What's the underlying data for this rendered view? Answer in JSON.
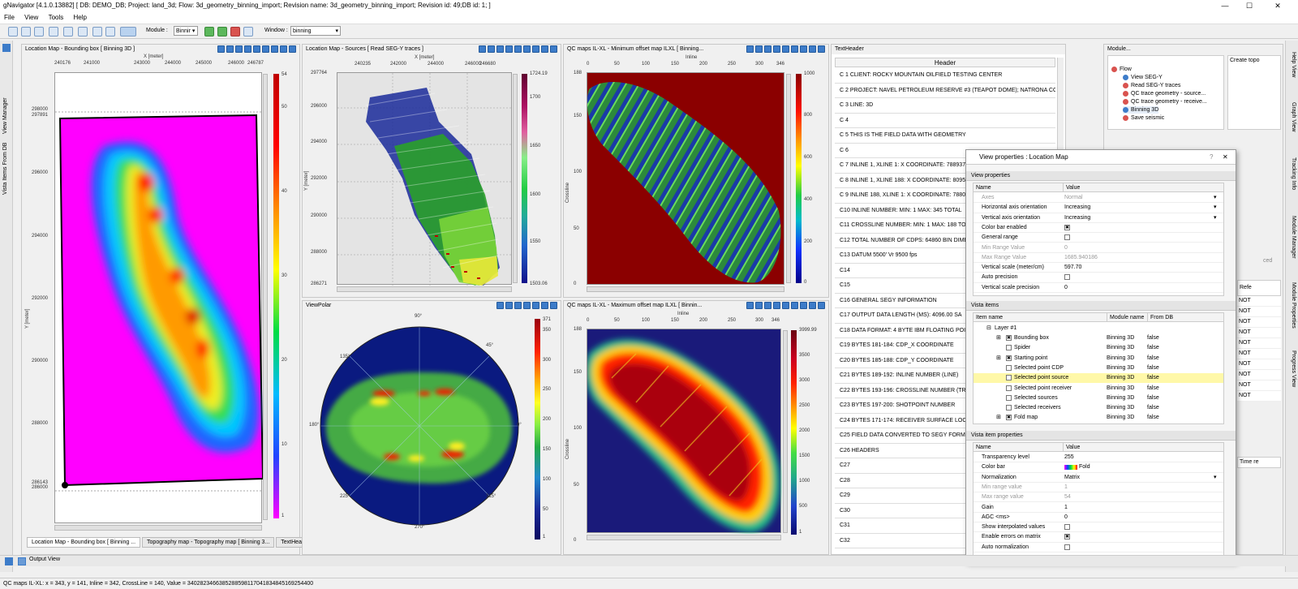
{
  "app": {
    "title": "gNavigator [4.1.0.13882] [ DB: DEMO_DB; Project: land_3d; Flow: 3d_geometry_binning_import; Revision name: 3d_geometry_binning_import; Revision id: 49;DB id: 1; ]",
    "menu": [
      "File",
      "View",
      "Tools",
      "Help"
    ],
    "toolbar": {
      "module_label": "Module :",
      "module_value": "Binnir",
      "window_label": "Window :",
      "window_value": "binning"
    }
  },
  "left_dock": {
    "tab1": "View Manager",
    "tab2": "Vista Items From DB"
  },
  "right_dock": {
    "tabs": [
      "Help View",
      "Graph View",
      "Tracking Info",
      "Module Manager",
      "Module Properties",
      "Progress View"
    ]
  },
  "panel1": {
    "title": "Location Map - Bounding box [ Binning 3D ]",
    "xaxis_title": "X [meter]",
    "yaxis_title": "Y [meter]",
    "xticks": [
      "240176",
      "241000",
      "243000",
      "244000",
      "245000",
      "246000",
      "246787"
    ],
    "yticks": [
      "298000",
      "297891",
      "296000",
      "294000",
      "292000",
      "290000",
      "288000",
      "286143",
      "286000"
    ],
    "cbar_ticks": [
      "54",
      "50",
      "40",
      "30",
      "20",
      "10",
      "1"
    ],
    "tabs": [
      "Location Map - Bounding box [ Binning ...",
      "Topography map - Topography map [ Binning 3...",
      "TextHea..."
    ]
  },
  "panel2": {
    "title": "Location Map - Sources [ Read SEG-Y traces ]",
    "xaxis_title": "X [meter]",
    "yaxis_title": "Y [meter]",
    "xticks": [
      "240235",
      "242000",
      "244000",
      "246000",
      "246680"
    ],
    "yticks": [
      "297764",
      "296000",
      "294000",
      "292000",
      "290000",
      "288000",
      "286271"
    ],
    "cbar_ticks": [
      "1724.19",
      "1700",
      "1650",
      "1600",
      "1550",
      "1503.06"
    ]
  },
  "panel3": {
    "title": "ViewPolar",
    "angles": [
      "90°",
      "45°",
      "0°",
      "315°",
      "270°",
      "225°",
      "180°",
      "135°"
    ],
    "cbar_ticks": [
      "371",
      "350",
      "300",
      "250",
      "200",
      "150",
      "100",
      "50",
      "1"
    ]
  },
  "panel4": {
    "title": "QC maps IL-XL - Minimum offset map ILXL [ Binning...",
    "xaxis_title": "Inline",
    "yaxis_title": "Crossline",
    "xticks": [
      "0",
      "50",
      "100",
      "150",
      "200",
      "250",
      "300",
      "346"
    ],
    "yticks": [
      "188",
      "150",
      "100",
      "50",
      "0"
    ],
    "cbar_ticks": [
      "1000",
      "800",
      "600",
      "400",
      "200",
      "0"
    ]
  },
  "panel5": {
    "title": "QC maps IL-XL - Maximum offset map ILXL [ Binnin...",
    "xaxis_title": "Inline",
    "yaxis_title": "Crossline",
    "xticks": [
      "0",
      "50",
      "100",
      "150",
      "200",
      "250",
      "300",
      "346"
    ],
    "yticks": [
      "188",
      "150",
      "100",
      "50",
      "0"
    ],
    "cbar_ticks": [
      "3999.99",
      "3500",
      "3000",
      "2500",
      "2000",
      "1500",
      "1000",
      "500",
      "1"
    ]
  },
  "textheader": {
    "title": "TextHeader",
    "column": "Header",
    "rows": [
      "C 1 CLIENT: ROCKY MOUNTAIN OILFIELD TESTING CENTER",
      "C 2 PROJECT: NAVEL PETROLEUM RESERVE #3 (TEAPOT DOME); NATRONA COUNT",
      "C 3 LINE: 3D",
      "C 4",
      "C 5 THIS IS THE FIELD DATA WITH GEOMETRY",
      "C 6",
      "C 7 INLINE 1, XLINE 1:   X COORDINATE: 788937",
      "C 8 INLINE 1, XLINE 188: X COORDINATE: 809501",
      "C 9 INLINE 188, XLINE 1: X COORDINATE: 788039",
      "C10 INLINE NUMBER:    MIN: 1  MAX: 345  TOTAL",
      "C11 CROSSLINE NUMBER: MIN: 1  MAX: 188  TOT",
      "C12 TOTAL NUMBER OF CDPS: 64860   BIN DIME",
      "C13 DATUM 5500'  Vr 9500 fps",
      "C14",
      "C15",
      "C16 GENERAL SEGY INFORMATION",
      "C17 OUTPUT DATA LENGTH (MS): 4096.00     SA",
      "C18 DATA FORMAT: 4 BYTE IBM FLOATING POI",
      "C19 BYTES 181-184: CDP_X COORDINATE",
      "C20 BYTES 185-188: CDP_Y COORDINATE",
      "C21 BYTES 189-192: INLINE NUMBER (LINE)",
      "C22 BYTES 193-196: CROSSLINE NUMBER (TRAC",
      "C23 BYTES 197-200: SHOTPOINT NUMBER",
      "C24 BYTES 171-174: RECEIVER SURFACE LOCATIO",
      "C25 FIELD DATA CONVERTED TO SEGY FORMATI",
      "C26 HEADERS",
      "C27",
      "C28",
      "C29",
      "C30",
      "C31",
      "C32"
    ]
  },
  "module_panel": {
    "title": "Module...",
    "side_label": "Create topo",
    "tree_root": "Flow",
    "tree": [
      "View SEG-Y",
      "Read SEG-Y traces",
      "QC trace geometry - source...",
      "QC trace geometry - receive...",
      "Binning 3D",
      "Save seismic"
    ],
    "partial_col": "Refe",
    "partial_rows": [
      "NOT",
      "NOT",
      "NOT",
      "NOT",
      "NOT",
      "NOT",
      "NOT",
      "NOT",
      "NOT",
      "NOT"
    ],
    "partial_other": "Time re",
    "partial_other2": "ced"
  },
  "view_props": {
    "title": "View properties : Location Map",
    "section1": "View properties",
    "col_name": "Name",
    "col_value": "Value",
    "props": [
      {
        "name": "Axes",
        "value": "Normal",
        "dim": true,
        "dropdown": true
      },
      {
        "name": "Horizontal axis orientation",
        "value": "Increasing",
        "dropdown": true
      },
      {
        "name": "Vertical axis orientation",
        "value": "Increasing",
        "dropdown": true
      },
      {
        "name": "Color bar enabled",
        "value": "✖",
        "check": true
      },
      {
        "name": "General range",
        "value": "",
        "check": true
      },
      {
        "name": "Min Range Value",
        "value": "0",
        "dim": true
      },
      {
        "name": "Max Range Value",
        "value": "1685.940186",
        "dim": true
      },
      {
        "name": "Vertical scale (meter/cm)",
        "value": "597.70"
      },
      {
        "name": "Auto precision",
        "value": "",
        "check": true
      },
      {
        "name": "Vertical scale precision",
        "value": "0"
      }
    ],
    "section2": "Vista items",
    "vcol_item": "Item name",
    "vcol_module": "Module name",
    "vcol_db": "From DB",
    "layer": "Layer #1",
    "items": [
      {
        "name": "Bounding box",
        "module": "Binning 3D",
        "db": "false",
        "checked": true,
        "expand": true
      },
      {
        "name": "Spider",
        "module": "Binning 3D",
        "db": "false",
        "checked": false
      },
      {
        "name": "Starting point",
        "module": "Binning 3D",
        "db": "false",
        "checked": true,
        "expand": true
      },
      {
        "name": "Selected point CDP",
        "module": "Binning 3D",
        "db": "false",
        "checked": false
      },
      {
        "name": "Selected point source",
        "module": "Binning 3D",
        "db": "false",
        "checked": false,
        "highlight": true
      },
      {
        "name": "Selected point receiver",
        "module": "Binning 3D",
        "db": "false",
        "checked": false
      },
      {
        "name": "Selected sources",
        "module": "Binning 3D",
        "db": "false",
        "checked": false
      },
      {
        "name": "Selected receivers",
        "module": "Binning 3D",
        "db": "false",
        "checked": false
      },
      {
        "name": "Fold map",
        "module": "Binning 3D",
        "db": "false",
        "checked": true,
        "expand": true
      }
    ],
    "section3": "Vista item properties",
    "iprops": [
      {
        "name": "Transparency level",
        "value": "255"
      },
      {
        "name": "Color bar",
        "value": "Fold",
        "swatch": true
      },
      {
        "name": "Normalization",
        "value": "Matrix",
        "dropdown": true
      },
      {
        "name": "Min range value",
        "value": "1",
        "dim": true
      },
      {
        "name": "Max range value",
        "value": "54",
        "dim": true
      },
      {
        "name": "Gain",
        "value": "1"
      },
      {
        "name": "AGC <ms>",
        "value": "0"
      },
      {
        "name": "Show interpolated values",
        "value": "",
        "check": true
      },
      {
        "name": "Enable errors on matrix",
        "value": "✖",
        "check": true
      },
      {
        "name": "Auto normalization",
        "value": "",
        "check": true
      }
    ]
  },
  "output_view": "Output View",
  "status": "QC maps IL-XL:  x = 343, y = 141, Inline = 342, CrossLine = 140, Value = 3402823466385288598117041834845169254400"
}
